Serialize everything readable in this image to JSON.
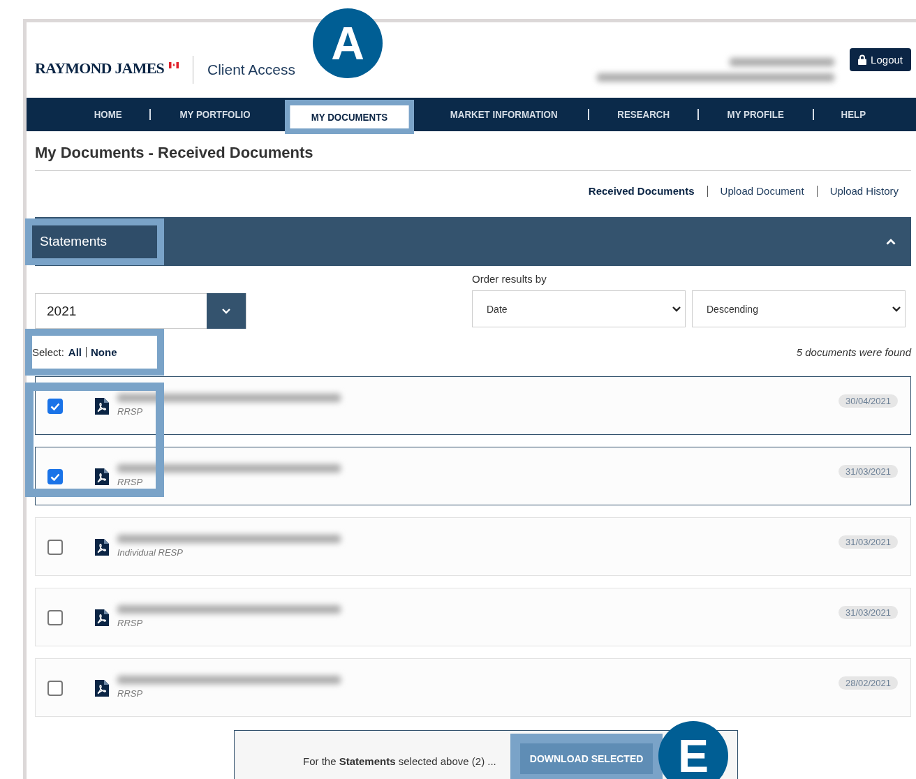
{
  "header": {
    "logo": "RAYMOND JAMES",
    "product": "Client Access",
    "logout": "Logout"
  },
  "nav": [
    {
      "label": "HOME",
      "selected": false
    },
    {
      "label": "MY PORTFOLIO",
      "selected": false
    },
    {
      "label": "MY DOCUMENTS",
      "selected": true
    },
    {
      "label": "MARKET INFORMATION",
      "selected": false
    },
    {
      "label": "RESEARCH",
      "selected": false
    },
    {
      "label": "MY PROFILE",
      "selected": false
    },
    {
      "label": "HELP",
      "selected": false
    }
  ],
  "page_title": "My Documents - Received Documents",
  "sub_links": [
    {
      "label": "Received Documents",
      "selected": true
    },
    {
      "label": "Upload Document",
      "selected": false
    },
    {
      "label": "Upload History",
      "selected": false
    }
  ],
  "section": {
    "title": "Statements",
    "expanded": true
  },
  "filters": {
    "year": "2021",
    "order_label": "Order results by",
    "order_by": "Date",
    "direction": "Descending"
  },
  "select": {
    "label": "Select:",
    "all": "All",
    "none": "None"
  },
  "result_count": "5 documents were found",
  "documents": [
    {
      "account": "RRSP",
      "date": "30/04/2021",
      "checked": true
    },
    {
      "account": "RRSP",
      "date": "31/03/2021",
      "checked": true
    },
    {
      "account": "Individual RESP",
      "date": "31/03/2021",
      "checked": false
    },
    {
      "account": "RRSP",
      "date": "31/03/2021",
      "checked": false
    },
    {
      "account": "RRSP",
      "date": "28/02/2021",
      "checked": false
    }
  ],
  "footer": {
    "text": "For the **Statements** selected above (2) ...",
    "button": "DOWNLOAD SELECTED"
  },
  "callouts": [
    {
      "label": "A"
    },
    {
      "label": "E"
    }
  ]
}
